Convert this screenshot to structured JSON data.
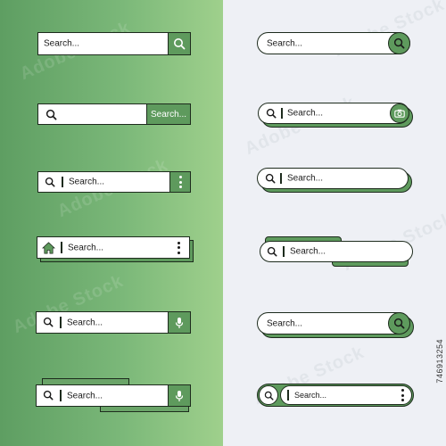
{
  "placeholder": "Search...",
  "button_label": "Search...",
  "stock_id": "746913254",
  "colors": {
    "accent": "#5e9a5d",
    "outline": "#1d2b1d",
    "bg_left": "#6fae6d",
    "bg_right": "#eef0f5"
  },
  "icons": [
    "search-icon",
    "camera-icon",
    "home-icon",
    "microphone-icon",
    "more-vertical-icon"
  ]
}
